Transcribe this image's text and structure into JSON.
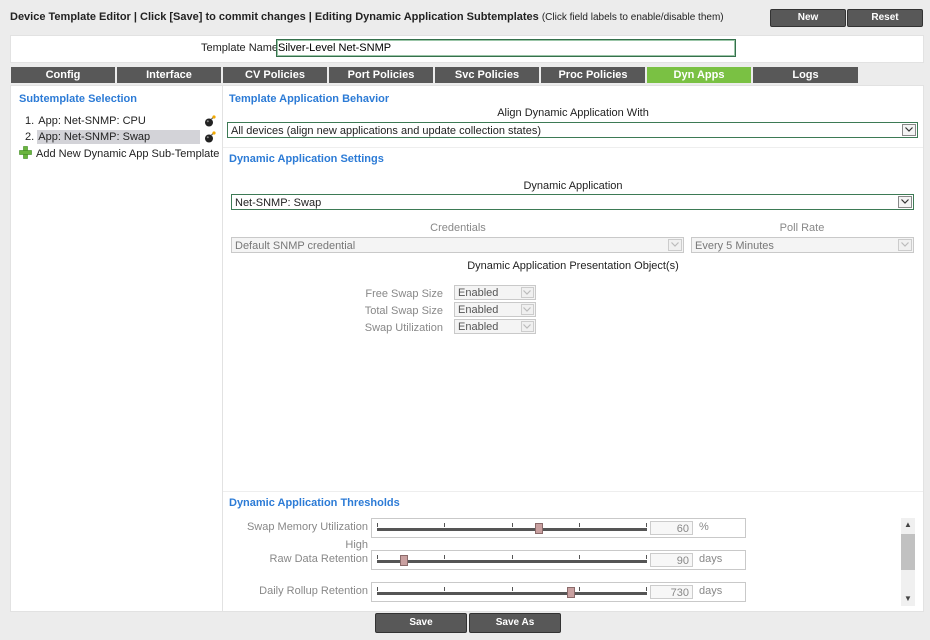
{
  "header": {
    "title": "Device Template Editor | Click [Save] to commit changes | Editing Dynamic Application Subtemplates",
    "note": "(Click field labels to enable/disable them)",
    "new_label": "New",
    "reset_label": "Reset"
  },
  "template_name": {
    "label": "Template Name",
    "value": "Silver-Level Net-SNMP"
  },
  "tabs": [
    {
      "label": "Config"
    },
    {
      "label": "Interface"
    },
    {
      "label": "CV Policies"
    },
    {
      "label": "Port Policies"
    },
    {
      "label": "Svc Policies"
    },
    {
      "label": "Proc Policies"
    },
    {
      "label": "Dyn Apps"
    },
    {
      "label": "Logs"
    }
  ],
  "active_tab": "Dyn Apps",
  "subtemplates": {
    "title": "Subtemplate Selection",
    "items": [
      {
        "num": "1.",
        "label": "App: Net-SNMP: CPU",
        "selected": false
      },
      {
        "num": "2.",
        "label": "App: Net-SNMP: Swap",
        "selected": true
      }
    ],
    "add_label": "Add New Dynamic App Sub-Template"
  },
  "behavior": {
    "title": "Template Application Behavior",
    "align_label": "Align Dynamic Application With",
    "align_value": "All devices (align new applications and update collection states)"
  },
  "settings": {
    "title": "Dynamic Application Settings",
    "app_label": "Dynamic Application",
    "app_value": "Net-SNMP: Swap",
    "credentials_label": "Credentials",
    "credentials_value": "Default SNMP credential",
    "poll_label": "Poll Rate",
    "poll_value": "Every 5 Minutes",
    "objects_label": "Dynamic Application Presentation Object(s)",
    "objects": [
      {
        "label": "Free Swap Size",
        "value": "Enabled"
      },
      {
        "label": "Total Swap Size",
        "value": "Enabled"
      },
      {
        "label": "Swap Utilization",
        "value": "Enabled"
      }
    ]
  },
  "thresholds": {
    "title": "Dynamic Application Thresholds",
    "items": [
      {
        "label": "Swap Memory Utilization",
        "sublabel": "High",
        "value": "60",
        "unit": "%",
        "level": 0.6
      },
      {
        "label": "Raw Data Retention",
        "sublabel": "",
        "value": "90",
        "unit": "days",
        "level": 0.1
      },
      {
        "label": "Daily Rollup Retention",
        "sublabel": "",
        "value": "730",
        "unit": "days",
        "level": 0.72
      }
    ]
  },
  "footer": {
    "save_label": "Save",
    "save_as_label": "Save As"
  },
  "colors": {
    "accent": "#2c7bd6",
    "active_tab": "#7ac143",
    "button": "#585858"
  }
}
